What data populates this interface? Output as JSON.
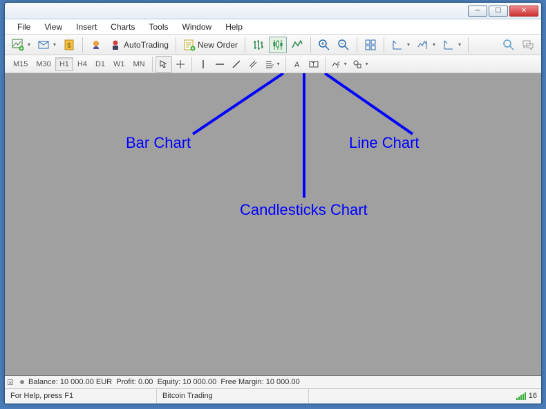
{
  "window": {
    "minimize": "─",
    "maximize": "☐",
    "close": "✕"
  },
  "menu": [
    "File",
    "View",
    "Insert",
    "Charts",
    "Tools",
    "Window",
    "Help"
  ],
  "toolbar1": {
    "autotrading": "AutoTrading",
    "neworder": "New Order"
  },
  "timeframes": [
    "M15",
    "M30",
    "H1",
    "H4",
    "D1",
    "W1",
    "MN"
  ],
  "timeframe_selected": "H1",
  "annotations": {
    "bar": "Bar Chart",
    "candle": "Candlesticks Chart",
    "line": "Line Chart"
  },
  "status": {
    "balance_label": "Balance:",
    "balance_value": "10 000.00 EUR",
    "profit_label": "Profit:",
    "profit_value": "0.00",
    "equity_label": "Equity:",
    "equity_value": "10 000.00",
    "freemargin_label": "Free Margin:",
    "freemargin_value": "10 000.00",
    "help": "For Help, press F1",
    "window_name": "Bitcoin Trading",
    "conn": "16"
  },
  "colors": {
    "annotation": "#0000ff",
    "workspace": "#a0a0a0"
  }
}
